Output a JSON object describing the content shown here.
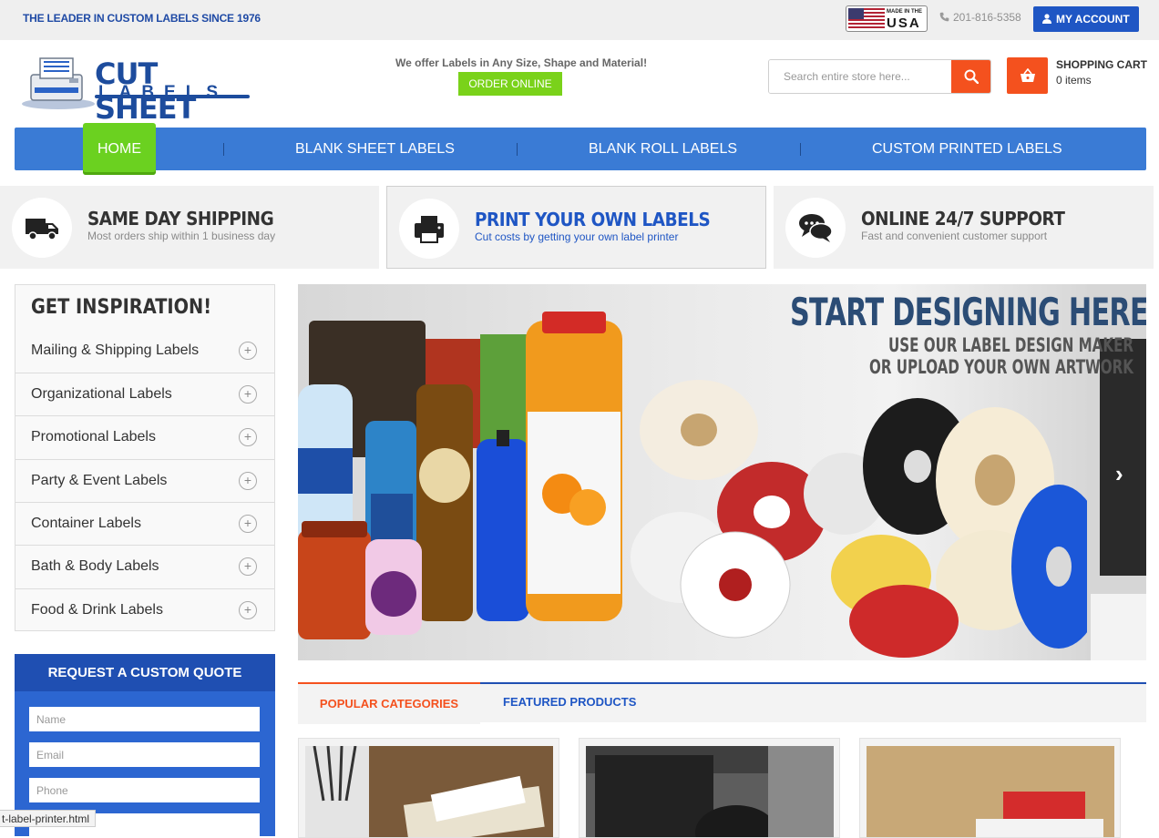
{
  "topbar": {
    "tagline": "THE LEADER IN CUSTOM LABELS SINCE 1976",
    "badge_made": "MADE IN THE",
    "badge_country": "USA",
    "phone": "201-816-5358",
    "account_label": "MY ACCOUNT"
  },
  "header": {
    "logo_line1": "CUT SHEET",
    "logo_line2": "LABELS",
    "offer": "We offer Labels in Any Size, Shape and Material!",
    "order_label": "ORDER ONLINE",
    "search_placeholder": "Search entire store here...",
    "cart_title": "SHOPPING CART",
    "cart_count": "0 items"
  },
  "nav": {
    "items": [
      "HOME",
      "BLANK SHEET LABELS",
      "BLANK ROLL LABELS",
      "CUSTOM PRINTED LABELS"
    ]
  },
  "features": [
    {
      "title": "SAME DAY SHIPPING",
      "subtitle": "Most orders ship within 1 business day",
      "icon": "truck-icon"
    },
    {
      "title": "PRINT YOUR OWN LABELS",
      "subtitle": "Cut costs by getting your own label printer",
      "icon": "printer-icon"
    },
    {
      "title": "ONLINE 24/7 SUPPORT",
      "subtitle": "Fast and convenient customer support",
      "icon": "chat-icon"
    }
  ],
  "sidebar": {
    "title": "GET INSPIRATION!",
    "items": [
      "Mailing & Shipping Labels",
      "Organizational Labels",
      "Promotional Labels",
      "Party & Event Labels",
      "Container Labels",
      "Bath & Body Labels",
      "Food & Drink Labels"
    ]
  },
  "quote": {
    "title": "REQUEST A CUSTOM QUOTE",
    "name_placeholder": "Name",
    "email_placeholder": "Email",
    "phone_placeholder": "Phone"
  },
  "banner": {
    "title": "START DESIGNING HERE!",
    "line1": "USE OUR LABEL DESIGN MAKER",
    "line2": "OR UPLOAD YOUR OWN ARTWORK"
  },
  "tabs": {
    "popular": "POPULAR CATEGORIES",
    "featured": "FEATURED PRODUCTS"
  },
  "status_bar": "t-label-printer.html",
  "colors": {
    "brand_blue": "#1f56c4",
    "nav_blue": "#3a7bd5",
    "accent_orange": "#f4511e",
    "accent_green": "#6bd120"
  }
}
